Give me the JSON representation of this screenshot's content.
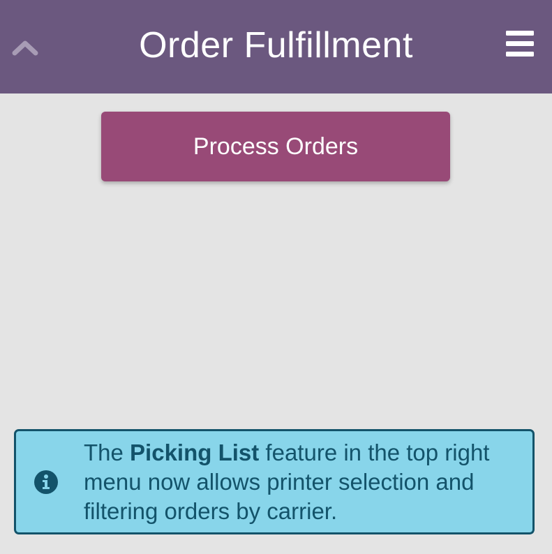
{
  "header": {
    "title": "Order Fulfillment",
    "background_color": "#6b587f",
    "back_icon": "chevron-up-icon",
    "menu_icon": "hamburger-menu-icon"
  },
  "main": {
    "process_orders_label": "Process Orders",
    "button_color": "#984a77"
  },
  "alert": {
    "icon": "info-circle-icon",
    "text_before": "The ",
    "text_bold": "Picking List",
    "text_after": " feature in the top right menu now allows printer selection and filtering orders by carrier.",
    "background_color": "#88d5ea",
    "text_color": "#13536a"
  }
}
